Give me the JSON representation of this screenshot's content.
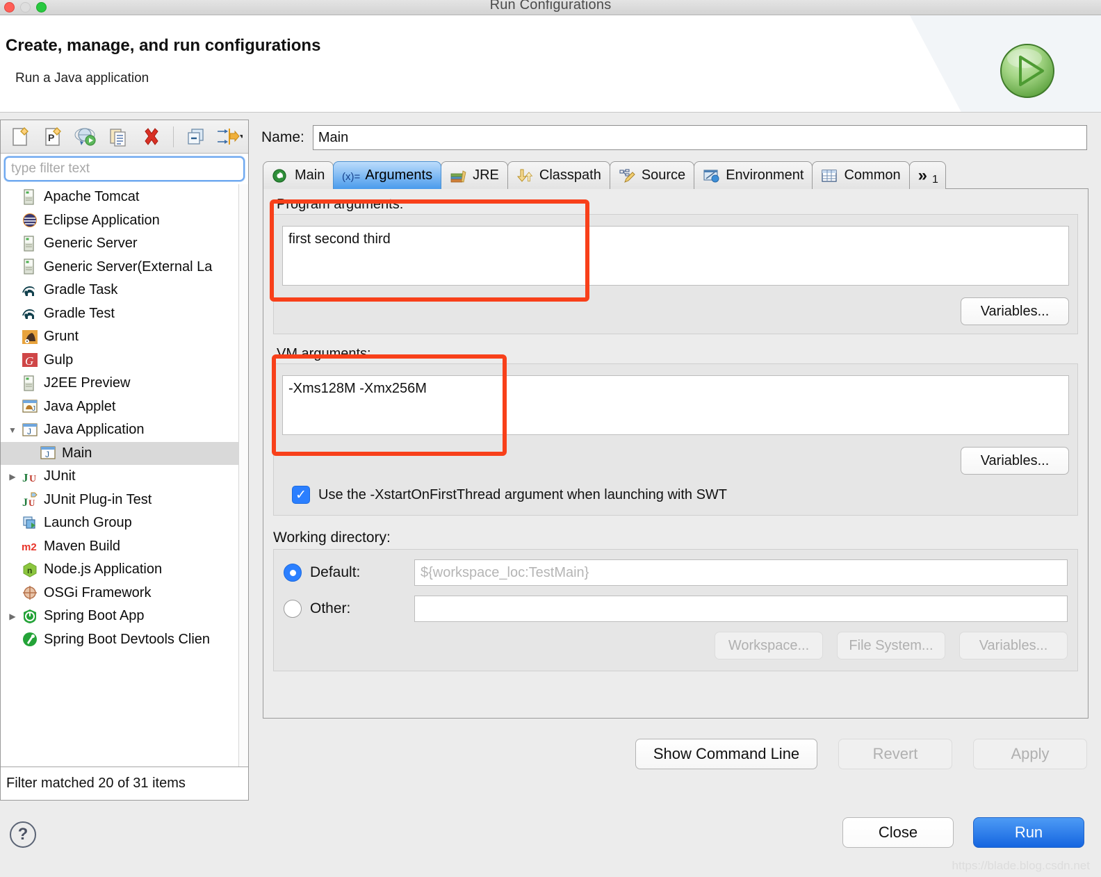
{
  "window": {
    "title": "Run Configurations",
    "traffic_lights": [
      "close",
      "minimize",
      "zoom"
    ]
  },
  "header": {
    "title": "Create, manage, and run configurations",
    "subtitle": "Run a Java application",
    "icon": "green-run-play-icon"
  },
  "left_panel": {
    "toolbar": [
      {
        "name": "new-configuration-icon",
        "label": "New launch configuration"
      },
      {
        "name": "new-prototype-icon",
        "label": "New prototype"
      },
      {
        "name": "export-configuration-icon",
        "label": "Export"
      },
      {
        "name": "duplicate-icon",
        "label": "Duplicate"
      },
      {
        "name": "delete-icon",
        "label": "Delete"
      },
      {
        "name": "collapse-all-icon",
        "label": "Collapse All"
      },
      {
        "name": "filter-icon",
        "label": "Filter"
      }
    ],
    "filter": {
      "placeholder": "type filter text",
      "value": ""
    },
    "tree": [
      {
        "label": "Apache Tomcat",
        "icon": "server-icon",
        "twisty": "",
        "depth": 0,
        "selected": false
      },
      {
        "label": "Eclipse Application",
        "icon": "eclipse-icon",
        "twisty": "",
        "depth": 0,
        "selected": false
      },
      {
        "label": "Generic Server",
        "icon": "server-icon",
        "twisty": "",
        "depth": 0,
        "selected": false
      },
      {
        "label": "Generic Server(External La",
        "icon": "server-icon",
        "twisty": "",
        "depth": 0,
        "selected": false
      },
      {
        "label": "Gradle Task",
        "icon": "gradle-icon",
        "twisty": "",
        "depth": 0,
        "selected": false
      },
      {
        "label": "Gradle Test",
        "icon": "gradle-icon",
        "twisty": "",
        "depth": 0,
        "selected": false
      },
      {
        "label": "Grunt",
        "icon": "grunt-icon",
        "twisty": "",
        "depth": 0,
        "selected": false
      },
      {
        "label": "Gulp",
        "icon": "gulp-icon",
        "twisty": "",
        "depth": 0,
        "selected": false
      },
      {
        "label": "J2EE Preview",
        "icon": "server-icon",
        "twisty": "",
        "depth": 0,
        "selected": false
      },
      {
        "label": "Java Applet",
        "icon": "java-applet-icon",
        "twisty": "",
        "depth": 0,
        "selected": false
      },
      {
        "label": "Java Application",
        "icon": "java-app-icon",
        "twisty": "expanded",
        "depth": 0,
        "selected": false
      },
      {
        "label": "Main",
        "icon": "java-app-icon",
        "twisty": "",
        "depth": 1,
        "selected": true
      },
      {
        "label": "JUnit",
        "icon": "junit-icon",
        "twisty": "collapsed",
        "depth": 0,
        "selected": false
      },
      {
        "label": "JUnit Plug-in Test",
        "icon": "junit-plugin-icon",
        "twisty": "",
        "depth": 0,
        "selected": false
      },
      {
        "label": "Launch Group",
        "icon": "launch-group-icon",
        "twisty": "",
        "depth": 0,
        "selected": false
      },
      {
        "label": "Maven Build",
        "icon": "maven-icon",
        "twisty": "",
        "depth": 0,
        "selected": false
      },
      {
        "label": "Node.js Application",
        "icon": "nodejs-icon",
        "twisty": "",
        "depth": 0,
        "selected": false
      },
      {
        "label": "OSGi Framework",
        "icon": "osgi-icon",
        "twisty": "",
        "depth": 0,
        "selected": false
      },
      {
        "label": "Spring Boot App",
        "icon": "spring-boot-icon",
        "twisty": "collapsed",
        "depth": 0,
        "selected": false
      },
      {
        "label": "Spring Boot Devtools Clien",
        "icon": "spring-devtools-icon",
        "twisty": "",
        "depth": 0,
        "selected": false
      }
    ],
    "status": "Filter matched 20 of 31 items"
  },
  "right_panel": {
    "name_label": "Name:",
    "name_value": "Main",
    "tabs": [
      {
        "label": "Main",
        "icon": "main-class-icon",
        "active": false
      },
      {
        "label": "Arguments",
        "icon": "arguments-xy-icon",
        "active": true
      },
      {
        "label": "JRE",
        "icon": "jre-books-icon",
        "active": false
      },
      {
        "label": "Classpath",
        "icon": "classpath-arrows-icon",
        "active": false
      },
      {
        "label": "Source",
        "icon": "source-pencil-icon",
        "active": false
      },
      {
        "label": "Environment",
        "icon": "environment-icon",
        "active": false
      },
      {
        "label": "Common",
        "icon": "common-table-icon",
        "active": false
      }
    ],
    "tabs_overflow": "1",
    "program_arguments": {
      "label": "Program arguments:",
      "value": "first second third",
      "variables_button": "Variables..."
    },
    "vm_arguments": {
      "label": "VM arguments:",
      "value": "-Xms128M -Xmx256M",
      "variables_button": "Variables..."
    },
    "swt_checkbox": {
      "label": "Use the -XstartOnFirstThread argument when launching with SWT",
      "checked": true
    },
    "working_directory": {
      "label": "Working directory:",
      "default_label": "Default:",
      "default_selected": true,
      "default_value": "${workspace_loc:TestMain}",
      "other_label": "Other:",
      "other_value": "",
      "buttons": [
        {
          "label": "Workspace...",
          "enabled": false
        },
        {
          "label": "File System...",
          "enabled": false
        },
        {
          "label": "Variables...",
          "enabled": false
        }
      ]
    },
    "action_buttons": [
      {
        "label": "Show Command Line",
        "enabled": true
      },
      {
        "label": "Revert",
        "enabled": false
      },
      {
        "label": "Apply",
        "enabled": false
      }
    ]
  },
  "footer": {
    "help_icon": "question-mark-icon",
    "close_button": "Close",
    "run_button": "Run",
    "watermark": "https://blade.blog.csdn.net"
  },
  "colors": {
    "annotation": "#f8401a",
    "accent_blue": "#2b7fff",
    "run_button": "#1565e0",
    "selection": "#d9d9d9"
  }
}
